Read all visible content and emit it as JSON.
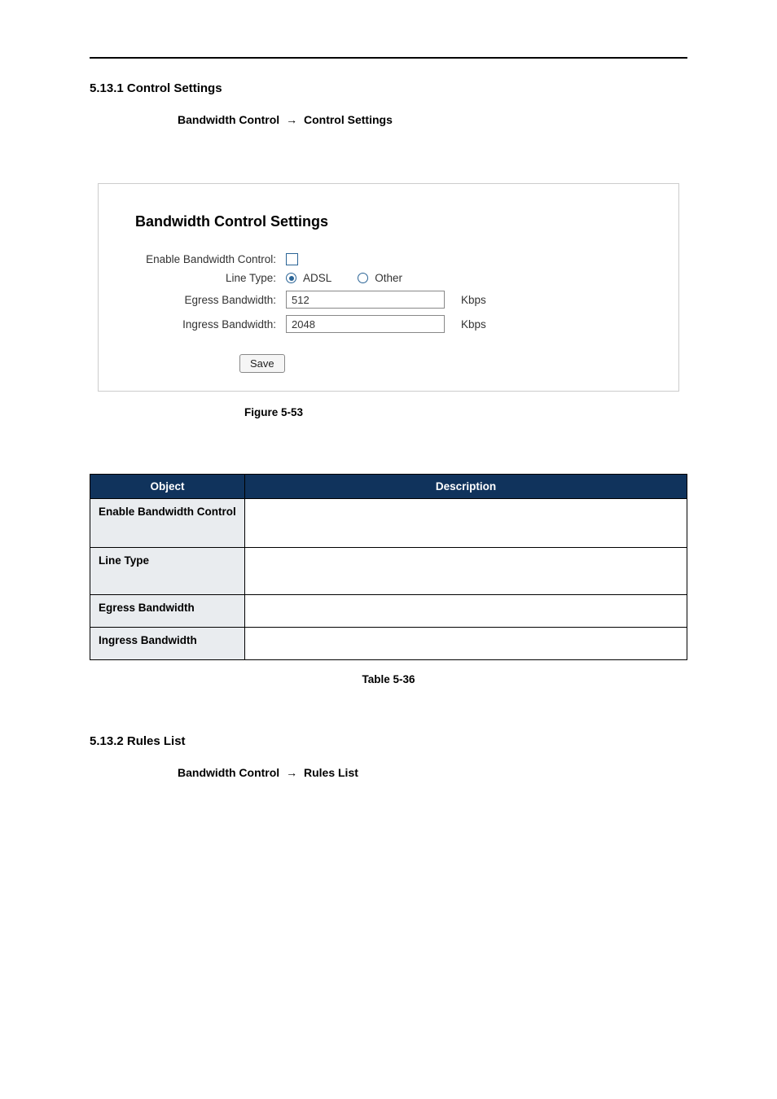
{
  "section1": {
    "heading": "5.13.1 Control Settings",
    "navA": "Bandwidth Control",
    "arrow": "→",
    "navB": "Control Settings"
  },
  "panel": {
    "title": "Bandwidth Control Settings",
    "enable_label": "Enable Bandwidth Control:",
    "linetype_label": "Line Type:",
    "egress_label": "Egress Bandwidth:",
    "ingress_label": "Ingress Bandwidth:",
    "linetype_opt1": "ADSL",
    "linetype_opt2": "Other",
    "egress_value": "512",
    "ingress_value": "2048",
    "unit": "Kbps",
    "save_label": "Save"
  },
  "figure_caption": "Figure 5-53",
  "table": {
    "head_obj": "Object",
    "head_desc": "Description",
    "rows": [
      {
        "obj": "Enable Bandwidth Control",
        "desc": ""
      },
      {
        "obj": "Line Type",
        "desc": ""
      },
      {
        "obj": "Egress Bandwidth",
        "desc": ""
      },
      {
        "obj": "Ingress Bandwidth",
        "desc": ""
      }
    ]
  },
  "table_caption": "Table 5-36",
  "section2": {
    "heading": "5.13.2 Rules List",
    "navA": "Bandwidth  Control",
    "arrow": "→",
    "navB": "Rules  List"
  }
}
